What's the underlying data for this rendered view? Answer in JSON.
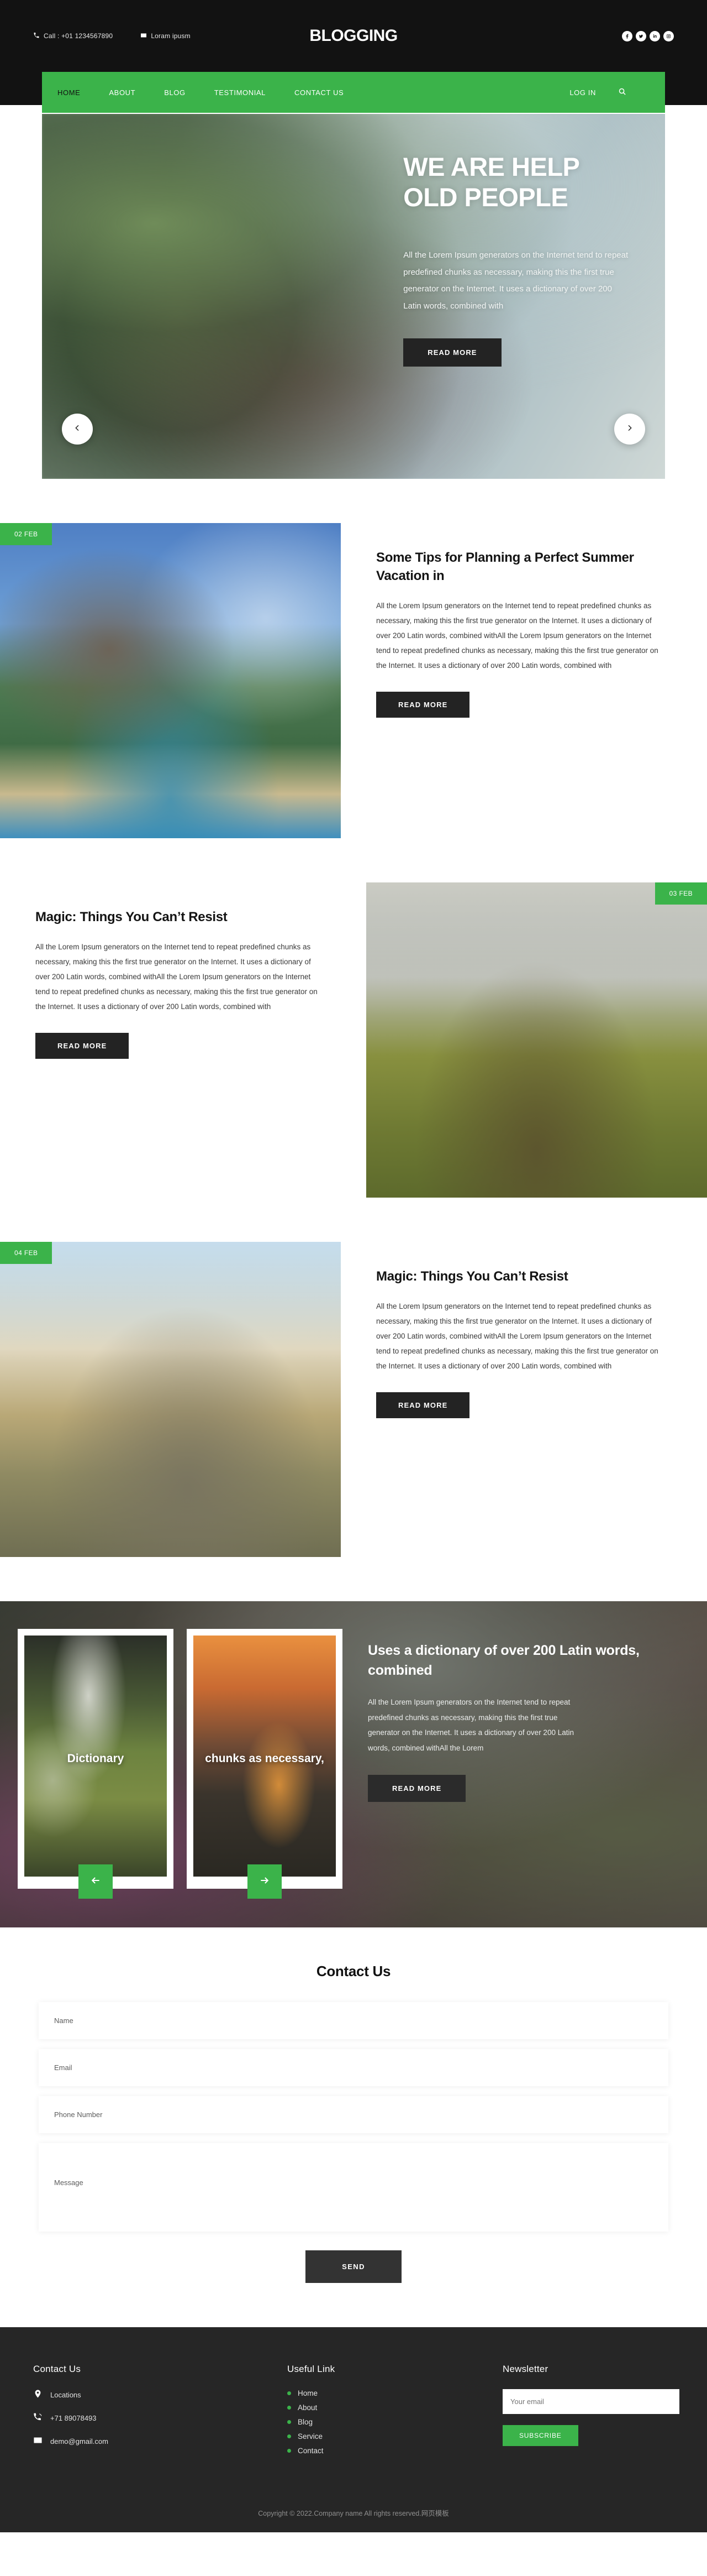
{
  "topbar": {
    "phone": "Call : +01 1234567890",
    "email": "Loram ipusm",
    "brand": "BLOGGING",
    "socials": [
      {
        "name": "facebook-icon",
        "glyph": "f"
      },
      {
        "name": "twitter-icon",
        "glyph": "t"
      },
      {
        "name": "linkedin-icon",
        "glyph": "in"
      },
      {
        "name": "instagram-icon",
        "glyph": "ig"
      }
    ]
  },
  "nav": {
    "items": [
      {
        "label": "HOME",
        "active": true
      },
      {
        "label": "ABOUT",
        "active": false
      },
      {
        "label": "BLOG",
        "active": false
      },
      {
        "label": "TESTIMONIAL",
        "active": false
      },
      {
        "label": "CONTACT US",
        "active": false
      }
    ],
    "login": "LOG IN",
    "search_icon": "search-icon"
  },
  "hero": {
    "title_line1": "WE ARE HELP",
    "title_line2": "OLD PEOPLE",
    "desc": "All the Lorem Ipsum generators on the Internet tend to repeat predefined chunks as necessary, making this the first true generator on the Internet. It uses a dictionary of over 200 Latin words, combined with",
    "cta": "READ MORE",
    "prev_icon": "chevron-left-icon",
    "next_icon": "chevron-right-icon"
  },
  "posts": [
    {
      "date": "02 FEB",
      "title": "Some Tips for Planning a Perfect Summer Vacation in",
      "body": "All the Lorem Ipsum generators on the Internet tend to repeat predefined chunks as necessary, making this the first true generator on the Internet. It uses a dictionary of over 200 Latin words, combined withAll the Lorem Ipsum generators on the Internet tend to repeat predefined chunks as necessary, making this the first true generator on the Internet. It uses a dictionary of over 200 Latin words, combined with",
      "cta": "READ MORE"
    },
    {
      "date": "03 FEB",
      "title": "Magic: Things You Can’t Resist",
      "body": "All the Lorem Ipsum generators on the Internet tend to repeat predefined chunks as necessary, making this the first true generator on the Internet. It uses a dictionary of over 200 Latin words, combined withAll the Lorem Ipsum generators on the Internet tend to repeat predefined chunks as necessary, making this the first true generator on the Internet. It uses a dictionary of over 200 Latin words, combined with",
      "cta": "READ MORE"
    },
    {
      "date": "04 FEB",
      "title": "Magic: Things You Can’t Resist",
      "body": "All the Lorem Ipsum generators on the Internet tend to repeat predefined chunks as necessary, making this the first true generator on the Internet. It uses a dictionary of over 200 Latin words, combined withAll the Lorem Ipsum generators on the Internet tend to repeat predefined chunks as necessary, making this the first true generator on the Internet. It uses a dictionary of over 200 Latin words, combined with",
      "cta": "READ MORE"
    }
  ],
  "testimonial": {
    "card1_label": "Dictionary",
    "card2_label": "chunks as necessary,",
    "title": "Uses a dictionary of over 200 Latin words, combined",
    "body": "All the Lorem Ipsum generators on the Internet tend to repeat predefined chunks as necessary, making this the first true generator on the Internet. It uses a dictionary of over 200 Latin words, combined withAll the Lorem",
    "cta": "READ MORE",
    "prev_icon": "arrow-left-icon",
    "next_icon": "arrow-right-icon"
  },
  "contact": {
    "heading": "Contact Us",
    "name_placeholder": "Name",
    "email_placeholder": "Email",
    "phone_placeholder": "Phone Number",
    "message_placeholder": "Message",
    "send_label": "SEND"
  },
  "footer": {
    "contact_heading": "Contact Us",
    "location": "Locations",
    "phone": "+71 89078493",
    "email": "demo@gmail.com",
    "links_heading": "Useful Link",
    "links": [
      "Home",
      "About",
      "Blog",
      "Service",
      "Contact"
    ],
    "newsletter_heading": "Newsletter",
    "newsletter_placeholder": "Your email",
    "subscribe_label": "SUBSCRIBE",
    "copyright": "Copyright © 2022.Company name All rights reserved.网页模板"
  },
  "colors": {
    "accent": "#3bb34a",
    "dark": "#121212",
    "footer_bg": "#262626",
    "button_dark": "#232323"
  }
}
